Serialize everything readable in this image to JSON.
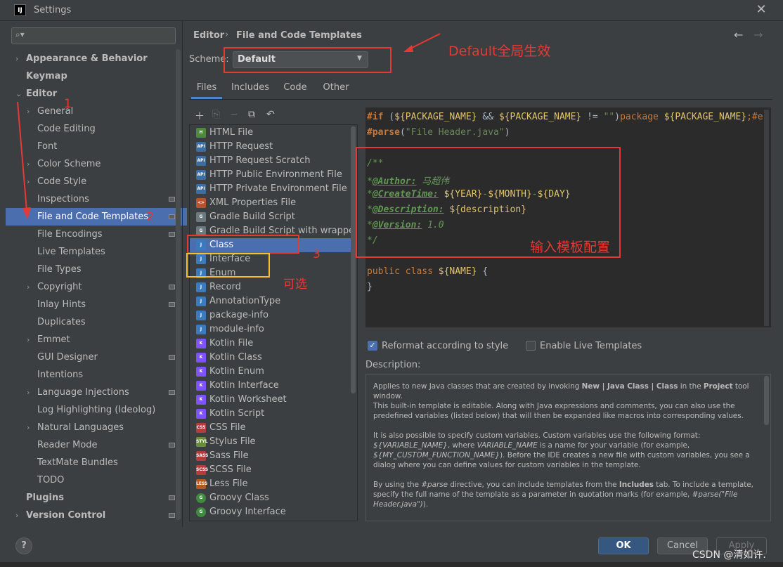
{
  "window": {
    "title": "Settings",
    "icon_label": "IJ"
  },
  "search": {
    "placeholder": ""
  },
  "sidebar": {
    "items": [
      {
        "label": "Appearance & Behavior",
        "level": 0,
        "expander": "collapsed",
        "bold": true
      },
      {
        "label": "Keymap",
        "level": 0,
        "bold": true
      },
      {
        "label": "Editor",
        "level": 0,
        "expander": "expanded",
        "bold": true
      },
      {
        "label": "General",
        "level": 1,
        "expander": "collapsed"
      },
      {
        "label": "Code Editing",
        "level": 1
      },
      {
        "label": "Font",
        "level": 1
      },
      {
        "label": "Color Scheme",
        "level": 1,
        "expander": "collapsed"
      },
      {
        "label": "Code Style",
        "level": 1,
        "expander": "collapsed"
      },
      {
        "label": "Inspections",
        "level": 1,
        "project_icon": true
      },
      {
        "label": "File and Code Templates",
        "level": 1,
        "selected": true,
        "project_icon": true
      },
      {
        "label": "File Encodings",
        "level": 1,
        "project_icon": true
      },
      {
        "label": "Live Templates",
        "level": 1
      },
      {
        "label": "File Types",
        "level": 1
      },
      {
        "label": "Copyright",
        "level": 1,
        "expander": "collapsed",
        "project_icon": true
      },
      {
        "label": "Inlay Hints",
        "level": 1,
        "project_icon": true
      },
      {
        "label": "Duplicates",
        "level": 1
      },
      {
        "label": "Emmet",
        "level": 1,
        "expander": "collapsed"
      },
      {
        "label": "GUI Designer",
        "level": 1,
        "project_icon": true
      },
      {
        "label": "Intentions",
        "level": 1
      },
      {
        "label": "Language Injections",
        "level": 1,
        "expander": "collapsed",
        "project_icon": true
      },
      {
        "label": "Log Highlighting (Ideolog)",
        "level": 1
      },
      {
        "label": "Natural Languages",
        "level": 1,
        "expander": "collapsed"
      },
      {
        "label": "Reader Mode",
        "level": 1,
        "project_icon": true
      },
      {
        "label": "TextMate Bundles",
        "level": 1
      },
      {
        "label": "TODO",
        "level": 1
      },
      {
        "label": "Plugins",
        "level": 0,
        "bold": true,
        "project_icon": true
      },
      {
        "label": "Version Control",
        "level": 0,
        "expander": "collapsed",
        "bold": true,
        "project_icon": true
      }
    ]
  },
  "breadcrumb": {
    "parent": "Editor",
    "separator": "›",
    "current": "File and Code Templates"
  },
  "scheme": {
    "label": "Scheme:",
    "value": "Default"
  },
  "tabs": [
    {
      "label": "Files",
      "active": true
    },
    {
      "label": "Includes"
    },
    {
      "label": "Code"
    },
    {
      "label": "Other"
    }
  ],
  "templates": [
    {
      "label": "HTML File",
      "icon": "html",
      "color": "#4e8a3e",
      "glyph": "H"
    },
    {
      "label": "HTTP Request",
      "icon": "api",
      "color": "#3b6ea5",
      "glyph": "API"
    },
    {
      "label": "HTTP Request Scratch",
      "icon": "api",
      "color": "#3b6ea5",
      "glyph": "API"
    },
    {
      "label": "HTTP Public Environment File",
      "icon": "api",
      "color": "#3b6ea5",
      "glyph": "API"
    },
    {
      "label": "HTTP Private Environment File",
      "icon": "api",
      "color": "#3b6ea5",
      "glyph": "API"
    },
    {
      "label": "XML Properties File",
      "icon": "xml",
      "color": "#b8532e",
      "glyph": "<>"
    },
    {
      "label": "Gradle Build Script",
      "icon": "gradle",
      "color": "#6c7a7f",
      "glyph": "G"
    },
    {
      "label": "Gradle Build Script with wrapper",
      "icon": "gradle",
      "color": "#6c7a7f",
      "glyph": "G"
    },
    {
      "label": "Class",
      "icon": "java",
      "color": "#3b7bbd",
      "glyph": "J",
      "selected": true
    },
    {
      "label": "Interface",
      "icon": "java",
      "color": "#3b7bbd",
      "glyph": "J"
    },
    {
      "label": "Enum",
      "icon": "java",
      "color": "#3b7bbd",
      "glyph": "J"
    },
    {
      "label": "Record",
      "icon": "java",
      "color": "#3b7bbd",
      "glyph": "J"
    },
    {
      "label": "AnnotationType",
      "icon": "java",
      "color": "#3b7bbd",
      "glyph": "J"
    },
    {
      "label": "package-info",
      "icon": "java",
      "color": "#3b7bbd",
      "glyph": "J"
    },
    {
      "label": "module-info",
      "icon": "java",
      "color": "#3b7bbd",
      "glyph": "J"
    },
    {
      "label": "Kotlin File",
      "icon": "kotlin",
      "color": "#7f52ff",
      "glyph": "K"
    },
    {
      "label": "Kotlin Class",
      "icon": "kotlin",
      "color": "#7f52ff",
      "glyph": "K"
    },
    {
      "label": "Kotlin Enum",
      "icon": "kotlin",
      "color": "#7f52ff",
      "glyph": "K"
    },
    {
      "label": "Kotlin Interface",
      "icon": "kotlin",
      "color": "#7f52ff",
      "glyph": "K"
    },
    {
      "label": "Kotlin Worksheet",
      "icon": "kotlin",
      "color": "#7f52ff",
      "glyph": "K"
    },
    {
      "label": "Kotlin Script",
      "icon": "kotlin",
      "color": "#7f52ff",
      "glyph": "K"
    },
    {
      "label": "CSS File",
      "icon": "css",
      "color": "#b43c3c",
      "glyph": "CSS"
    },
    {
      "label": "Stylus File",
      "icon": "stylus",
      "color": "#6a8f3a",
      "glyph": "STYL"
    },
    {
      "label": "Sass File",
      "icon": "sass",
      "color": "#b43c3c",
      "glyph": "SASS"
    },
    {
      "label": "SCSS File",
      "icon": "scss",
      "color": "#b43c3c",
      "glyph": "SCSS"
    },
    {
      "label": "Less File",
      "icon": "less",
      "color": "#b45a1e",
      "glyph": "LESS"
    },
    {
      "label": "Groovy Class",
      "icon": "groovy",
      "color": "#3f8a3f",
      "glyph": "G"
    },
    {
      "label": "Groovy Interface",
      "icon": "groovy",
      "color": "#3f8a3f",
      "glyph": "G"
    }
  ],
  "editor": {
    "l1_if": "#if",
    "l1_open": " (",
    "l1_var1": "${PACKAGE_NAME}",
    "l1_and": " && ",
    "l1_var2": "${PACKAGE_NAME}",
    "l1_ne": " != ",
    "l1_str": "\"\"",
    "l1_close": ")",
    "l1_pkg": "package",
    "l1_sp": " ",
    "l1_var3": "${PACKAGE_NAME}",
    "l1_tail": ";#e",
    "l2_parse": "#parse",
    "l2_open": "(",
    "l2_str": "\"File Header.java\"",
    "l2_close": ")",
    "l4": "/**",
    "l5_star": "*",
    "l5_tag": "@Author:",
    "l5_val": " 马超伟",
    "l6_star": "*",
    "l6_tag": "@CreateTime:",
    "l6_sp": " ",
    "l6_v1": "${YEAR}",
    "l6_d1": "-",
    "l6_v2": "${MONTH}",
    "l6_d2": "-",
    "l6_v3": "${DAY}",
    "l7_star": "*",
    "l7_tag": "@Description:",
    "l7_sp": " ",
    "l7_v": "${description}",
    "l8_star": "*",
    "l8_tag": "@Version:",
    "l8_val": " 1.0",
    "l9": "*/",
    "l11_public": "public class ",
    "l11_name": "${NAME}",
    "l11_brace": " {",
    "l12": "}"
  },
  "options": {
    "reformat_label": "Reformat according to style",
    "reformat_checked": true,
    "live_label": "Enable Live Templates",
    "live_checked": false
  },
  "description": {
    "label": "Description:",
    "p1_a": "Applies to new Java classes that are created by invoking ",
    "p1_b": "New | Java Class | Class",
    "p1_c": " in the ",
    "p1_d": "Project",
    "p1_e": " tool window.",
    "p1_f": "This built-in template is editable. Along with Java expressions and comments, you can also use the predefined variables (listed below) that will then be expanded like macros into corresponding values.",
    "p2_a": "It is also possible to specify custom variables. Custom variables use the following format: ",
    "p2_b": "${VARIABLE_NAME}",
    "p2_c": ", where ",
    "p2_d": "VARIABLE_NAME",
    "p2_e": " is a name for your variable (for example, ",
    "p2_f": "${MY_CUSTOM_FUNCTION_NAME}",
    "p2_g": "). Before the IDE creates a new file with custom variables, you see a dialog where you can define values for custom variables in the template.",
    "p3_a": "By using the ",
    "p3_b": "#parse",
    "p3_c": " directive, you can include templates from the ",
    "p3_d": "Includes",
    "p3_e": " tab. To include a template, specify the full name of the template as a parameter in quotation marks (for example, ",
    "p3_f": "#parse(\"File Header.java\")",
    "p3_g": ")."
  },
  "buttons": {
    "help": "?",
    "ok": "OK",
    "cancel": "Cancel",
    "apply": "Apply"
  },
  "annotations": {
    "scheme_note": "Default全局生效",
    "n1": "1",
    "n2": "2",
    "n3": "3",
    "template_note": "输入模板配置",
    "optional_note": "可选",
    "watermark": "CSDN @清如许."
  },
  "colors": {
    "selection": "#4b6eaf",
    "annotation_red": "#e53935",
    "annotation_yellow": "#f6c026",
    "ok_button": "#365880"
  }
}
